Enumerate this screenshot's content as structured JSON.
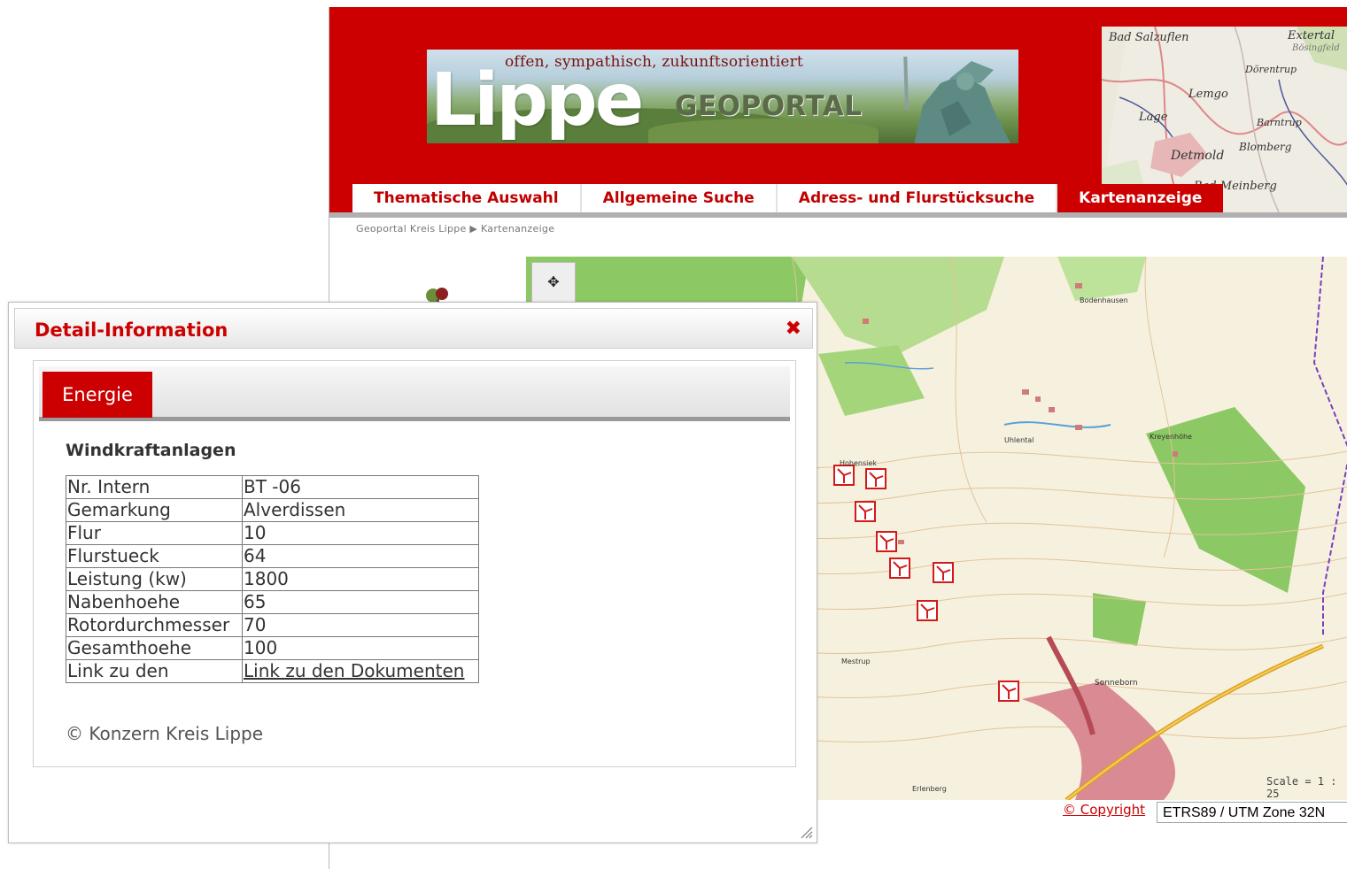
{
  "header": {
    "tagline": "offen, sympathisch, zukunftsorientiert",
    "logo_text": "Lippe",
    "portal_text": "GEOPORTAL",
    "map_labels": [
      "Bad Salzuflen",
      "Extertal",
      "Bösingfeld",
      "Dörentrup",
      "Lemgo",
      "Lage",
      "Barntrup",
      "Blomberg",
      "Detmold",
      "Bad Meinberg"
    ]
  },
  "nav": {
    "items": [
      {
        "label": "Thematische Auswahl",
        "active": false
      },
      {
        "label": "Allgemeine Suche",
        "active": false
      },
      {
        "label": "Adress- und Flurstücksuche",
        "active": false
      },
      {
        "label": "Kartenanzeige",
        "active": true
      }
    ]
  },
  "breadcrumb": "Geoportal Kreis Lippe ▶ Kartenanzeige",
  "map": {
    "place_labels": [
      "Bodenhausen",
      "Uhlental",
      "Sonneborn",
      "Kreyenhöhe",
      "Erlenberg",
      "Mestrup",
      "Hohensiek"
    ],
    "scale_text": "Scale = 1 : 25",
    "copyright_link": "© Copyright",
    "crs_value": "ETRS89 / UTM Zone 32N",
    "symbol_color": "#d11a1a"
  },
  "dialog": {
    "title": "Detail-Information",
    "close_glyph": "✖",
    "tab_label": "Energie",
    "section_title": "Windkraftanlagen",
    "rows": [
      {
        "key": "Nr. Intern",
        "value": "BT -06"
      },
      {
        "key": "Gemarkung",
        "value": "Alverdissen"
      },
      {
        "key": "Flur",
        "value": "10"
      },
      {
        "key": "Flurstueck",
        "value": "64"
      },
      {
        "key": "Leistung (kw)",
        "value": "1800"
      },
      {
        "key": "Nabenhoehe",
        "value": "65"
      },
      {
        "key": "Rotordurchmesser",
        "value": "70"
      },
      {
        "key": "Gesamthoehe",
        "value": "100"
      }
    ],
    "link_row": {
      "key": "Link zu den",
      "value": "Link zu den Dokumenten"
    },
    "footer": "© Konzern Kreis Lippe"
  },
  "colors": {
    "brand_red": "#cc0000",
    "forest_green": "#8cc863",
    "map_bg": "#f6f1de"
  }
}
